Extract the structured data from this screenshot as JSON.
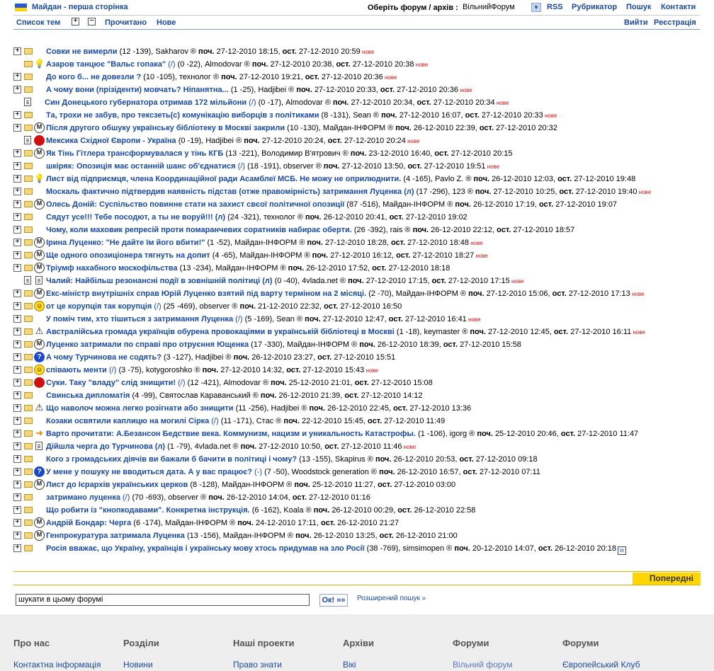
{
  "header": {
    "site_title": "Майдан - перша сторінка",
    "forum_select_label": "Оберіть форум / архів :",
    "forum_select_value": "ВільнийФорум",
    "links": [
      "RSS",
      "Рубрикатор",
      "Пошук",
      "Контакти"
    ]
  },
  "subnav": {
    "topics_list": "Список тем",
    "read": "Прочитано",
    "new": "Нове",
    "login": "Вийти",
    "register": "Реєстрація"
  },
  "topics": [
    {
      "exp": true,
      "icon": "folder",
      "mark": "",
      "title": "Совки не вимерли",
      "stats": "(12 -139),",
      "author": "Sakharov",
      "start": "27-12-2010 18:15",
      "last": "27-12-2010 20:59",
      "new": "нове"
    },
    {
      "exp": false,
      "icon": "folder",
      "mark": "bulb",
      "title": "Азаров танцює \"Вальс гопака\"",
      "edit": "(/)",
      "stats": "(0 -22),",
      "author": "Almodovar",
      "start": "27-12-2010 20:38",
      "last": "27-12-2010 20:38",
      "new": "нове"
    },
    {
      "exp": true,
      "icon": "folder",
      "mark": "",
      "title": "До кого б... не довезли ?",
      "stats": "(10 -105),",
      "author": "технолог",
      "start": "27-12-2010 19:21",
      "last": "27-12-2010 20:36",
      "new": "нове"
    },
    {
      "exp": true,
      "icon": "folder",
      "mark": "",
      "title": "А чому вони (прізіденти) мовчать? Ніпанятна...",
      "stats": "(1 -25),",
      "author": "Hadjibei",
      "start": "27-12-2010 20:33",
      "last": "27-12-2010 20:36",
      "new": "нове"
    },
    {
      "exp": false,
      "icon": "doc",
      "mark": "",
      "title": "Син Донецького губернатора отримав 172 мільйони",
      "edit": "(/)",
      "stats": "(0 -17),",
      "author": "Almodovar",
      "start": "27-12-2010 20:34",
      "last": "27-12-2010 20:34",
      "new": "нове"
    },
    {
      "exp": true,
      "icon": "folder",
      "mark": "",
      "title": "Та, трохи не забув, про тексзеть(с) комунікацію виборців з політиками",
      "stats": "(8 -131),",
      "author": "Sean",
      "start": "27-12-2010 16:07",
      "last": "27-12-2010 20:33",
      "new": "нове"
    },
    {
      "exp": true,
      "icon": "folder",
      "mark": "maidan",
      "title": "Після другого обшуку українську бібліотеку в Москві закрили",
      "stats": "(10 -130),",
      "author": "Майдан-ІНФОРМ",
      "start": "26-12-2010 22:39",
      "last": "27-12-2010 20:32",
      "new": ""
    },
    {
      "exp": false,
      "icon": "doc",
      "mark": "red",
      "title": "Мексика Східної Європи - Україна",
      "stats": "(0 -19),",
      "author": "Hadjibei",
      "start": "27-12-2010 20:24",
      "last": "27-12-2010 20:24",
      "new": "нове"
    },
    {
      "exp": true,
      "icon": "folder",
      "mark": "maidan",
      "title": "Як Тінь Гітлера трансформувалася у тінь КГБ",
      "stats": "(13 -221),",
      "author": "Володимир В'ятрович",
      "start": "23-12-2010 16:40",
      "last": "27-12-2010 20:15",
      "new": ""
    },
    {
      "exp": true,
      "icon": "folder",
      "mark": "",
      "title": "шкіряк: Опозиція має останній шанс об'єднатися",
      "edit": "(/)",
      "stats": "(18 -191),",
      "author": "observer",
      "start": "27-12-2010 13:50",
      "last": "27-12-2010 19:51",
      "new": "нове"
    },
    {
      "exp": true,
      "icon": "folder",
      "mark": "bulb",
      "title": "Лист від підприємця, члена Координаційної ради Асамблеї МСБ. Не можу не оприлюднити.",
      "stats": "(4 -165),",
      "author": "Pavlo Z.",
      "start": "26-12-2010 12:03",
      "last": "27-12-2010 19:48",
      "new": ""
    },
    {
      "exp": true,
      "icon": "folder",
      "mark": "",
      "title": "Москаль фактично підтвердив наявність підстав (отже правомірність) затримання Луценка (л)",
      "stats": "(17 -296),",
      "author": "123",
      "start": "27-12-2010 10:25",
      "last": "27-12-2010 19:40",
      "new": "нове"
    },
    {
      "exp": true,
      "icon": "folder",
      "mark": "maidan",
      "title": "Олесь Доній: Суспільство повинне стати на захист свєої політичної опозиції",
      "stats": "(87 -516),",
      "author": "Майдан-ІНФОРМ",
      "start": "26-12-2010 17:19",
      "last": "27-12-2010 19:07",
      "new": ""
    },
    {
      "exp": true,
      "icon": "folder",
      "mark": "",
      "title": "Сядут усе!!! Тебе посодют, а ты не воруй!!! (л)",
      "stats": "(24 -321),",
      "author": "технолог",
      "start": "26-12-2010 20:41",
      "last": "27-12-2010 19:02",
      "new": ""
    },
    {
      "exp": true,
      "icon": "folder",
      "mark": "",
      "title": "Чому, коли маховик репресій проти помаранчевих соратників набирає оберти.",
      "stats": "(26 -392),",
      "author": "rais",
      "start": "26-12-2010 22:12",
      "last": "27-12-2010 18:57",
      "new": ""
    },
    {
      "exp": true,
      "icon": "folder",
      "mark": "maidan",
      "title": "Ірина Луценко: \"Не дайте їм його вбити!\"",
      "stats": "(1 -52),",
      "author": "Майдан-ІНФОРМ",
      "start": "27-12-2010 18:28",
      "last": "27-12-2010 18:48",
      "new": "нове"
    },
    {
      "exp": true,
      "icon": "folder",
      "mark": "maidan",
      "title": "Ще одного опозиціонера тягнуть на допит",
      "stats": "(4 -65),",
      "author": "Майдан-ІНФОРМ",
      "start": "27-12-2010 16:12",
      "last": "27-12-2010 18:27",
      "new": "нове"
    },
    {
      "exp": true,
      "icon": "folder",
      "mark": "maidan",
      "title": "Тріумф нахабного москофільства",
      "stats": "(13 -234),",
      "author": "Майдан-ІНФОРМ",
      "start": "26-12-2010 17:52",
      "last": "27-12-2010 18:18",
      "new": ""
    },
    {
      "exp": false,
      "icon": "doc",
      "mark": "doc",
      "title": "Чалий: Найбільш резонансні події в зовнішній політиці (л)",
      "stats": "(0 -40),",
      "author": "4vlada.net",
      "start": "27-12-2010 17:15",
      "last": "27-12-2010 17:15",
      "new": "нове"
    },
    {
      "exp": true,
      "icon": "folder",
      "mark": "maidan",
      "title": "Екс-міністр внутрішніх справ Юрій Луценко взятий під варту терміном на 2 місяці.",
      "stats": "(2 -70),",
      "author": "Майдан-ІНФОРМ",
      "start": "27-12-2010 15:06",
      "last": "27-12-2010 17:13",
      "new": "нове"
    },
    {
      "exp": true,
      "icon": "folder",
      "mark": "smile",
      "title": "от це корупція так корупція",
      "edit": "(/)",
      "stats": "(25 -469),",
      "author": "observer",
      "start": "21-12-2010 22:32",
      "last": "27-12-2010 16:50",
      "new": ""
    },
    {
      "exp": true,
      "icon": "folder",
      "mark": "",
      "title": "У поміч тим, хто тішиться з затримання Луценка",
      "edit": "(/)",
      "stats": "(5 -169),",
      "author": "Sean",
      "start": "27-12-2010 12:47",
      "last": "27-12-2010 16:41",
      "new": "нове"
    },
    {
      "exp": true,
      "icon": "folder",
      "mark": "warn",
      "title": "Австралійська громада українців обурена провокаціями в українській бібліотеці в Москві",
      "stats": "(1 -18),",
      "author": "keymaster",
      "start": "27-12-2010 12:45",
      "last": "27-12-2010 16:11",
      "new": "нове"
    },
    {
      "exp": true,
      "icon": "folder",
      "mark": "maidan",
      "title": "Луценко затримали по справі про отруєння Ющенка",
      "stats": "(17 -330),",
      "author": "Майдан-ІНФОРМ",
      "start": "26-12-2010 18:39",
      "last": "27-12-2010 15:58",
      "new": ""
    },
    {
      "exp": true,
      "icon": "folder",
      "mark": "blue",
      "title": "А чому Турчинова не содять?",
      "stats": "(3 -127),",
      "author": "Hadjibei",
      "start": "26-12-2010 23:27",
      "last": "27-12-2010 15:51",
      "new": ""
    },
    {
      "exp": true,
      "icon": "folder",
      "mark": "smile",
      "title": "співають менти",
      "edit": "(/)",
      "stats": "(3 -75),",
      "author": "kotygoroshko",
      "start": "27-12-2010 14:32",
      "last": "27-12-2010 15:43",
      "new": "нове"
    },
    {
      "exp": true,
      "icon": "folder",
      "mark": "red",
      "title": "Суки. Таку \"владу\" слід знищити!",
      "edit": "(/)",
      "stats": "(12 -421),",
      "author": "Almodovar",
      "start": "25-12-2010 21:01",
      "last": "27-12-2010 15:08",
      "new": ""
    },
    {
      "exp": true,
      "icon": "folder",
      "mark": "",
      "title": "Свинська дипломатія",
      "stats": "(4 -99),",
      "author": "Святослав Караванський",
      "start": "26-12-2010 21:39",
      "last": "27-12-2010 14:12",
      "new": ""
    },
    {
      "exp": true,
      "icon": "folder",
      "mark": "warn",
      "title": "Що наволоч можна легко розігнати або знищити",
      "stats": "(11 -256),",
      "author": "Hadjibei",
      "start": "26-12-2010 22:45",
      "last": "27-12-2010 13:36",
      "new": ""
    },
    {
      "exp": true,
      "icon": "folder",
      "mark": "",
      "title": "Козаки освятили каплицю на могилі Сірка",
      "edit": "(/)",
      "stats": "(11 -171),",
      "author": "Стас",
      "start": "22-12-2010 15:45",
      "last": "27-12-2010 11:49",
      "new": ""
    },
    {
      "exp": true,
      "icon": "folder",
      "mark": "arrow",
      "title": "Варто прочитати: А.Безансон Бедствие века. Коммунизм, нацизм и уникальность Катастрофы.",
      "stats": "(1 -106),",
      "author": "igorg",
      "start": "25-12-2010 20:46",
      "last": "27-12-2010 11:47",
      "new": "",
      "plain": true
    },
    {
      "exp": true,
      "icon": "folder",
      "mark": "doc",
      "title": "Дійшла черга до Турчинова (л)",
      "stats": "(1 -79),",
      "author": "4vlada.net",
      "start": "27-12-2010 10:50",
      "last": "27-12-2010 11:46",
      "new": "нове"
    },
    {
      "exp": true,
      "icon": "folder",
      "mark": "",
      "title": "Кого з громадських діячів ви бажали б бачити в політиці і чому?",
      "stats": "(13 -155),",
      "author": "Skapirus",
      "start": "26-12-2010 20:53",
      "last": "27-12-2010 09:18",
      "new": ""
    },
    {
      "exp": true,
      "icon": "folder",
      "mark": "blue",
      "title": "У мене у пошуку не вводиться дата. А у вас працює?",
      "edit": "(-)",
      "stats": "(7 -50),",
      "author": "Woodstock generation",
      "start": "26-12-2010 16:57",
      "last": "27-12-2010 07:11",
      "new": ""
    },
    {
      "exp": true,
      "icon": "folder",
      "mark": "maidan",
      "title": "Лист до Ієрархів українських церков",
      "stats": "(8 -128),",
      "author": "Майдан-ІНФОРМ",
      "start": "25-12-2010 11:27",
      "last": "27-12-2010 03:00",
      "new": ""
    },
    {
      "exp": true,
      "icon": "folder",
      "mark": "",
      "title": "затримано луценка",
      "edit": "(/)",
      "stats": "(70 -693),",
      "author": "observer",
      "start": "26-12-2010 14:04",
      "last": "27-12-2010 01:16",
      "new": ""
    },
    {
      "exp": true,
      "icon": "folder",
      "mark": "",
      "title": "Що робити із \"кнопкодавами\". Конкретна інструкція.",
      "stats": "(6 -162),",
      "author": "Koala",
      "start": "26-12-2010 00:29",
      "last": "26-12-2010 22:58",
      "new": ""
    },
    {
      "exp": true,
      "icon": "folder",
      "mark": "maidan",
      "title": "Андрій Бондар: Черга",
      "stats": "(6 -174),",
      "author": "Майдан-ІНФОРМ",
      "start": "24-12-2010 17:11",
      "last": "26-12-2010 21:27",
      "new": ""
    },
    {
      "exp": true,
      "icon": "folder",
      "mark": "maidan",
      "title": "Генпрокуратура затримала Луценка",
      "stats": "(13 -156),",
      "author": "Майдан-ІНФОРМ",
      "start": "26-12-2010 13:25",
      "last": "26-12-2010 21:00",
      "new": ""
    },
    {
      "exp": true,
      "icon": "folder",
      "mark": "",
      "title": "Росія вважає, що Україну, українців і українську мову хтось придумав на зло Росії",
      "stats": "(38 -769),",
      "author": "simsimopen",
      "start": "20-12-2010 14:07",
      "last": "26-12-2010 20:18",
      "new": "",
      "attach": true
    }
  ],
  "labels": {
    "start": "поч.",
    "last": "ост.",
    "reg": "®"
  },
  "pager": {
    "prev": "Попередні"
  },
  "search": {
    "value": "шукати в цьому форумі",
    "ok": "Ок! »»",
    "advanced": "Розширений пошук »"
  },
  "footer": {
    "cols": [
      {
        "head": "Про нас",
        "link": "Контактна інформація"
      },
      {
        "head": "Розділи",
        "link": "Новини"
      },
      {
        "head": "Наші проекти",
        "link": "Право знати"
      },
      {
        "head": "Архіви",
        "link": "Вікі"
      },
      {
        "head": "Форуми",
        "link": "Вільний форум"
      },
      {
        "head": "Форуми",
        "link": "Європейський Клуб"
      }
    ]
  }
}
